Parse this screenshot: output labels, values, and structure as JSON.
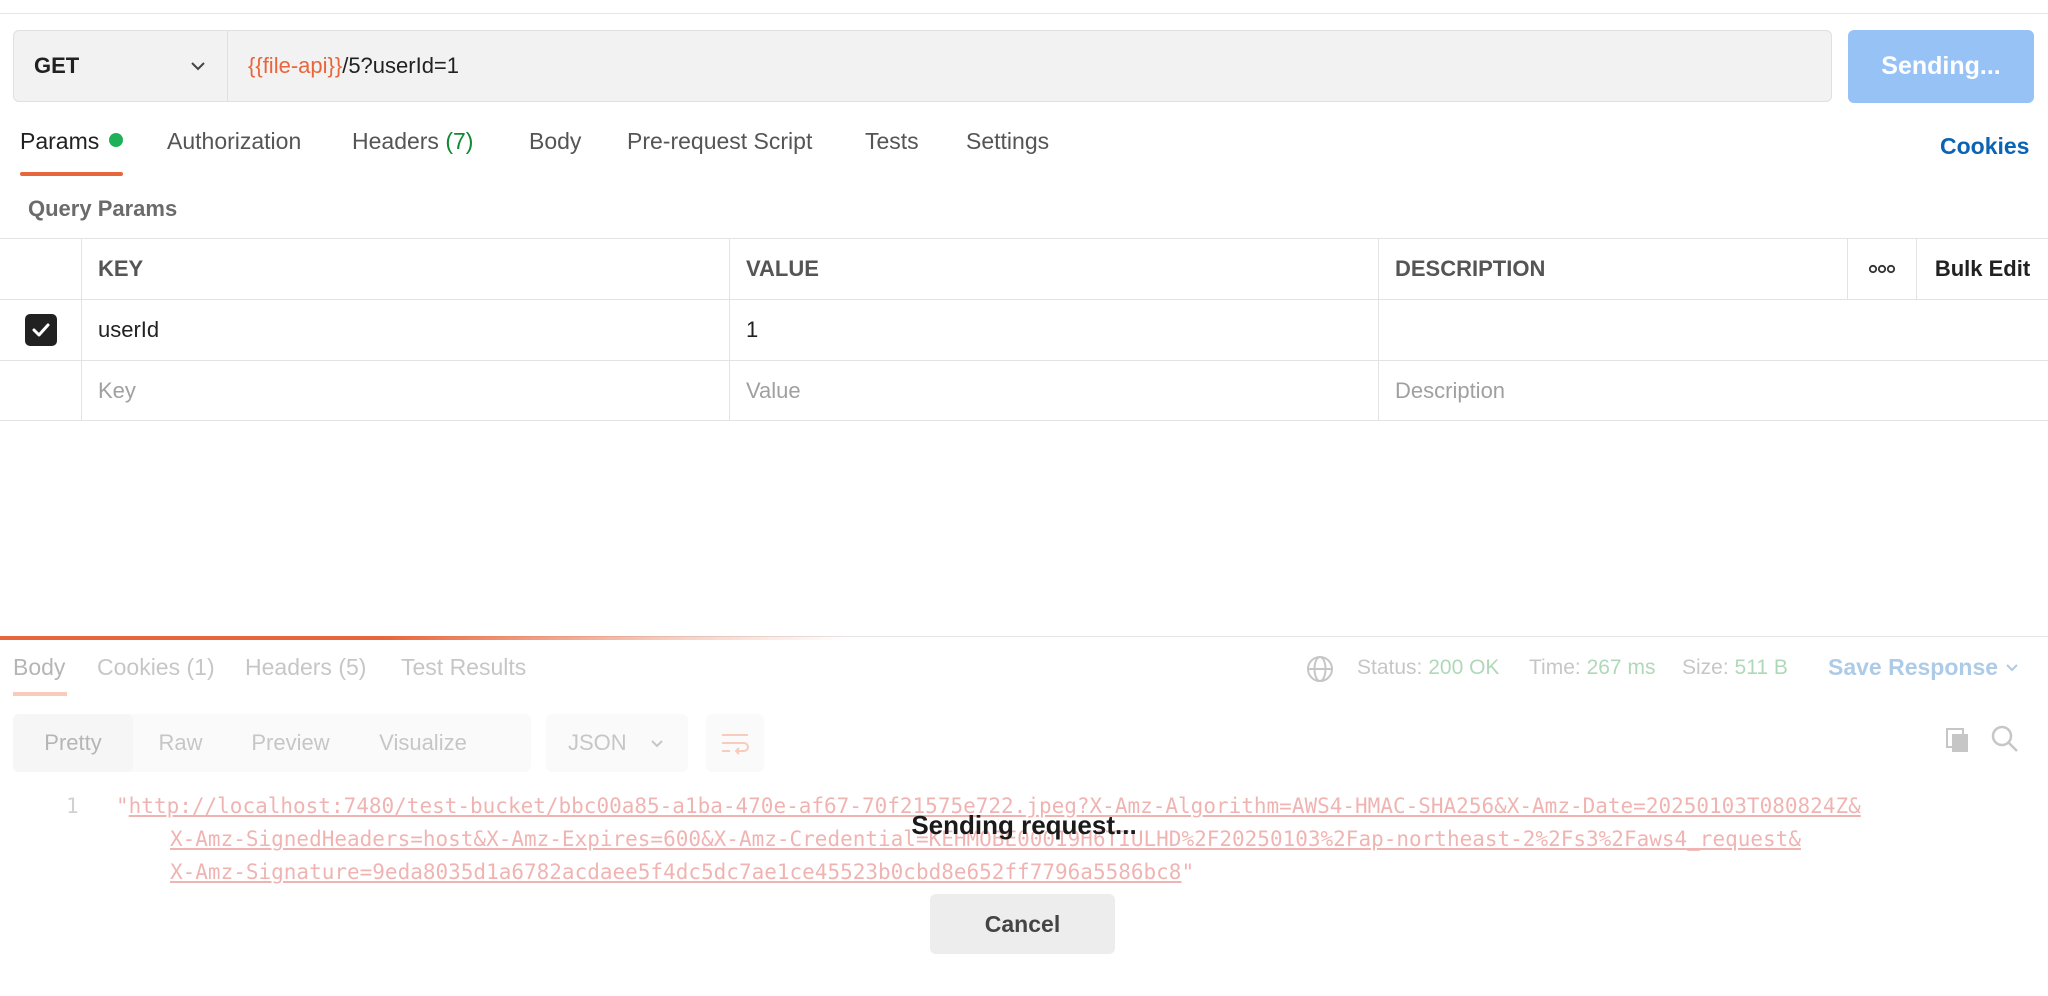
{
  "request": {
    "method": "GET",
    "url_variable": "{{file-api}}",
    "url_rest": "/5?userId=1",
    "send_label": "Sending..."
  },
  "tabs": [
    {
      "label": "Params",
      "active": true
    },
    {
      "label": "Authorization"
    },
    {
      "label": "Headers",
      "count": "(7)"
    },
    {
      "label": "Body"
    },
    {
      "label": "Pre-request Script"
    },
    {
      "label": "Tests"
    },
    {
      "label": "Settings"
    }
  ],
  "cookies_label": "Cookies",
  "query_params": {
    "title": "Query Params",
    "columns": {
      "key": "KEY",
      "value": "VALUE",
      "description": "DESCRIPTION",
      "bulk_edit": "Bulk Edit"
    },
    "rows": [
      {
        "checked": true,
        "key": "userId",
        "value": "1",
        "description": ""
      }
    ],
    "placeholders": {
      "key": "Key",
      "value": "Value",
      "description": "Description"
    }
  },
  "response": {
    "tabs": [
      {
        "label": "Body",
        "active": true
      },
      {
        "label": "Cookies",
        "count": "(1)"
      },
      {
        "label": "Headers",
        "count": "(5)"
      },
      {
        "label": "Test Results"
      }
    ],
    "status_label": "Status:",
    "status_value": "200 OK",
    "time_label": "Time:",
    "time_value": "267 ms",
    "size_label": "Size:",
    "size_value": "511 B",
    "save_label": "Save Response",
    "formats": [
      "Pretty",
      "Raw",
      "Preview",
      "Visualize"
    ],
    "language": "JSON",
    "line_number": "1",
    "body_lines": [
      "http://localhost:7480/test-bucket/bbc00a85-a1ba-470e-af67-70f21575e722.jpeg?X-Amz-Algorithm=AWS4-HMAC-SHA256&X-Amz-Date=20250103T080824Z&",
      "X-Amz-SignedHeaders=host&X-Amz-Expires=600&X-Amz-Credential=KEHMOBE00019H6TIULHD%2F20250103%2Fap-northeast-2%2Fs3%2Faws4_request&",
      "X-Amz-Signature=9eda8035d1a6782acdaee5f4dc5dc7ae1ce45523b0cbd8e652ff7796a5586bc8"
    ]
  },
  "overlay": {
    "message": "Sending request...",
    "cancel_label": "Cancel"
  },
  "colors": {
    "accent": "#e8663b",
    "link": "#0b63b5",
    "send_button": "#97c2f6",
    "active_dot": "#1fb15a"
  }
}
